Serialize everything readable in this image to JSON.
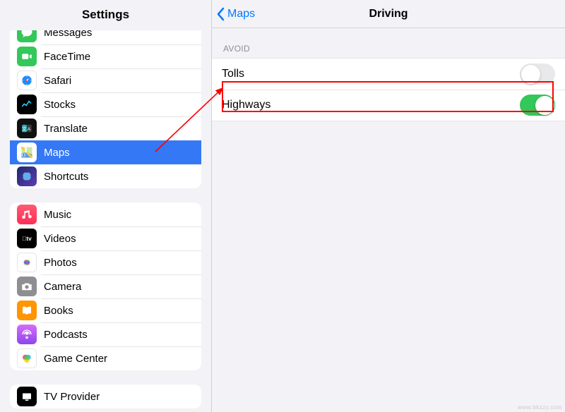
{
  "sidebar": {
    "title": "Settings",
    "groups": [
      {
        "items": [
          {
            "id": "messages",
            "label": "Messages"
          },
          {
            "id": "facetime",
            "label": "FaceTime"
          },
          {
            "id": "safari",
            "label": "Safari"
          },
          {
            "id": "stocks",
            "label": "Stocks"
          },
          {
            "id": "translate",
            "label": "Translate"
          },
          {
            "id": "maps",
            "label": "Maps",
            "selected": true
          },
          {
            "id": "shortcuts",
            "label": "Shortcuts"
          }
        ]
      },
      {
        "items": [
          {
            "id": "music",
            "label": "Music"
          },
          {
            "id": "videos",
            "label": "Videos"
          },
          {
            "id": "photos",
            "label": "Photos"
          },
          {
            "id": "camera",
            "label": "Camera"
          },
          {
            "id": "books",
            "label": "Books"
          },
          {
            "id": "podcasts",
            "label": "Podcasts"
          },
          {
            "id": "gamecenter",
            "label": "Game Center"
          }
        ]
      },
      {
        "items": [
          {
            "id": "tvprovider",
            "label": "TV Provider"
          }
        ]
      }
    ]
  },
  "detail": {
    "back_label": "Maps",
    "title": "Driving",
    "section_header": "AVOID",
    "rows": [
      {
        "label": "Tolls",
        "value": false
      },
      {
        "label": "Highways",
        "value": true
      }
    ]
  },
  "annotation": {
    "highlight_target": "Highways row",
    "arrow_from": "sidebar Maps item",
    "arrow_to": "Highways row"
  }
}
